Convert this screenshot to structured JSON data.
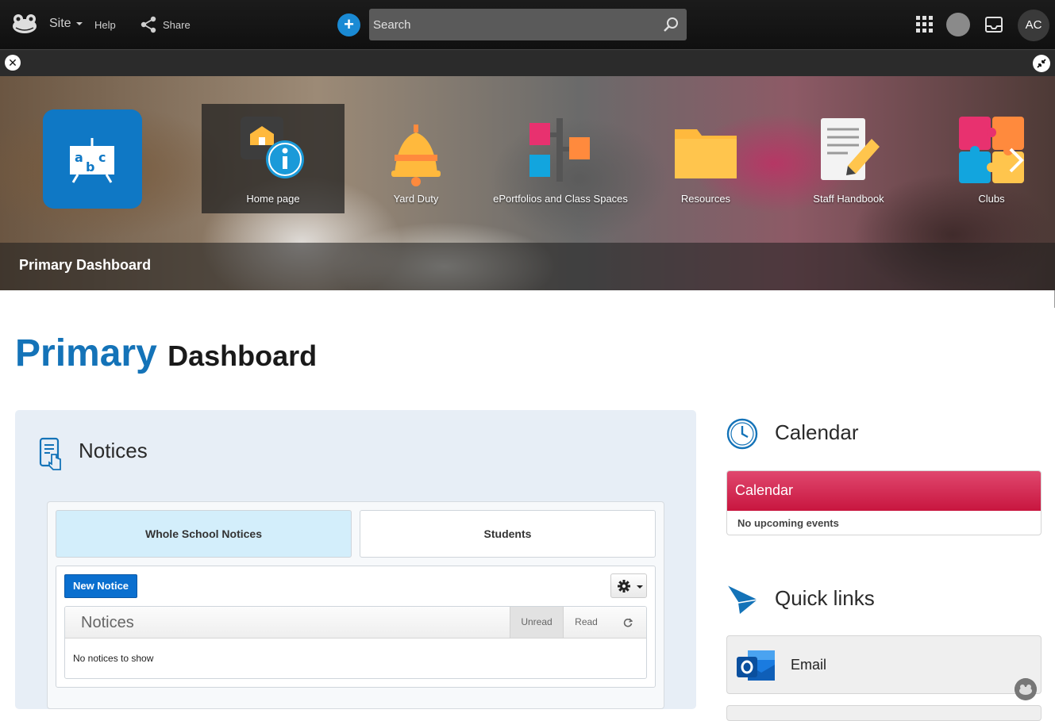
{
  "topbar": {
    "site_label": "Site",
    "help_label": "Help",
    "share_label": "Share",
    "search_placeholder": "Search",
    "avatar_initials": "AC"
  },
  "banner": {
    "title": "Primary Dashboard",
    "tiles": [
      {
        "label": "Home page"
      },
      {
        "label": "Yard Duty"
      },
      {
        "label": "ePortfolios and Class Spaces"
      },
      {
        "label": "Resources"
      },
      {
        "label": "Staff Handbook"
      },
      {
        "label": "Clubs"
      }
    ]
  },
  "heading": {
    "primary": "Primary",
    "secondary": "Dashboard"
  },
  "notices": {
    "title": "Notices",
    "tabs": [
      "Whole School Notices",
      "Students"
    ],
    "new_notice_label": "New Notice",
    "list_title": "Notices",
    "filter_unread": "Unread",
    "filter_read": "Read",
    "empty_text": "No notices to show"
  },
  "calendar": {
    "title": "Calendar",
    "header": "Calendar",
    "empty_text": "No upcoming events"
  },
  "quick_links": {
    "title": "Quick links",
    "items": [
      {
        "label": "Email"
      }
    ]
  },
  "colors": {
    "accent": "#1473b8",
    "calendar_header": "#d3234d",
    "new_notice": "#0a6fcf"
  }
}
